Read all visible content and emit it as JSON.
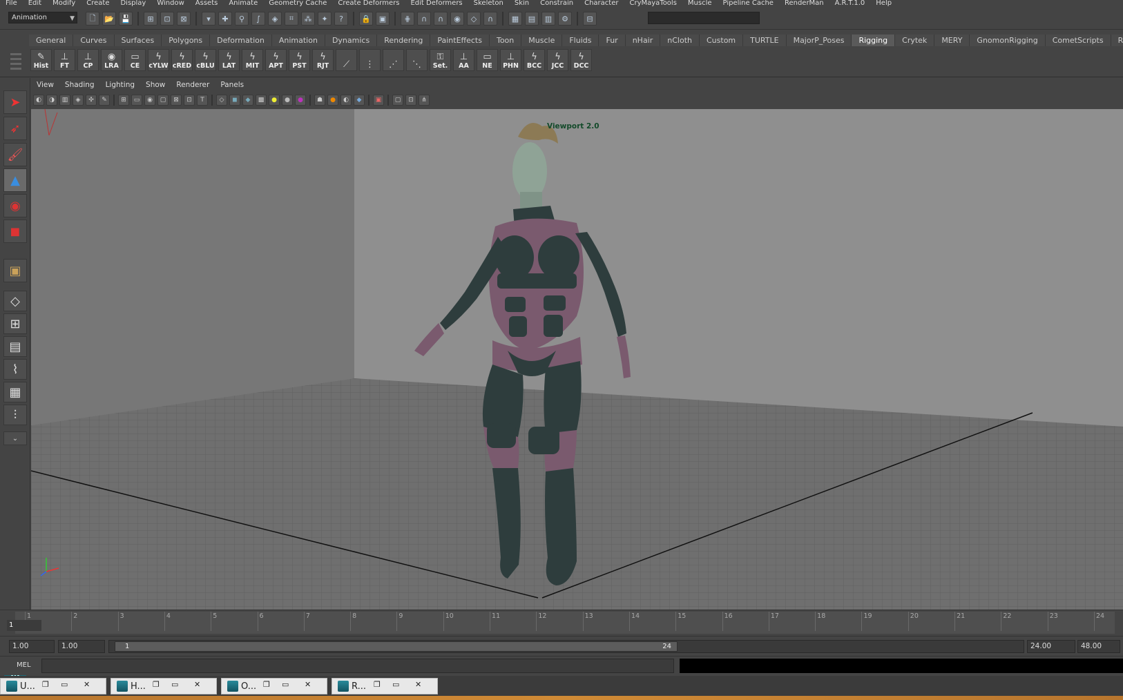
{
  "menubar": [
    "File",
    "Edit",
    "Modify",
    "Create",
    "Display",
    "Window",
    "Assets",
    "Animate",
    "Geometry Cache",
    "Create Deformers",
    "Edit Deformers",
    "Skeleton",
    "Skin",
    "Constrain",
    "Character",
    "CryMayaTools",
    "Muscle",
    "Pipeline Cache",
    "RenderMan",
    "A.R.T.1.0",
    "Help"
  ],
  "statusline": {
    "mode": "Animation"
  },
  "shelf": {
    "tabs": [
      "General",
      "Curves",
      "Surfaces",
      "Polygons",
      "Deformation",
      "Animation",
      "Dynamics",
      "Rendering",
      "PaintEffects",
      "Toon",
      "Muscle",
      "Fluids",
      "Fur",
      "nHair",
      "nCloth",
      "Custom",
      "TURTLE",
      "MajorP_Poses",
      "Rigging",
      "Crytek",
      "MERY",
      "GnomonRigging",
      "CometScripts",
      "RenderMan"
    ],
    "active_tab": "Rigging",
    "buttons": [
      "Hist",
      "FT",
      "CP",
      "LRA",
      "CE",
      "cYLW",
      "cRED",
      "cBLU",
      "LAT",
      "MIT",
      "APT",
      "PST",
      "RJT",
      "",
      "",
      "",
      "",
      "Set.",
      "AA",
      "NE",
      "PHN",
      "BCC",
      "JCC",
      "DCC"
    ]
  },
  "panel": {
    "menus": [
      "View",
      "Shading",
      "Lighting",
      "Show",
      "Renderer",
      "Panels"
    ]
  },
  "viewport": {
    "label": "Viewport 2.0"
  },
  "timeslider": {
    "ticks": [
      "1",
      "2",
      "3",
      "4",
      "5",
      "6",
      "7",
      "8",
      "9",
      "10",
      "11",
      "12",
      "13",
      "14",
      "15",
      "16",
      "17",
      "18",
      "19",
      "20",
      "21",
      "22",
      "23",
      "24"
    ],
    "current_frame": "1"
  },
  "rangeslider": {
    "start_time": "1.00",
    "range_start_field": "1.00",
    "range_start": "1",
    "range_end": "24",
    "range_end_field": "24.00",
    "end_time": "48.00"
  },
  "cmdline": {
    "label": "MEL"
  },
  "minimized_windows": [
    "U...",
    "H...",
    "O...",
    "R..."
  ],
  "colors": {
    "viewport_bg": "#7e7e7e",
    "suit_dark": "#2e3d3d",
    "suit_pink": "#7a5a6e",
    "skin": "#8fa396"
  }
}
